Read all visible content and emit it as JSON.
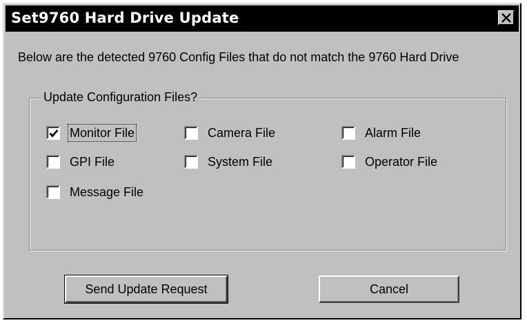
{
  "window": {
    "title": "Set9760 Hard Drive Update",
    "close_icon": "close-x-icon"
  },
  "description": "Below are the detected 9760 Config Files that do not match the 9760 Hard Drive",
  "group": {
    "legend": "Update Configuration Files?",
    "items": [
      {
        "label": "Monitor File",
        "checked": true,
        "focused": true
      },
      {
        "label": "Camera File",
        "checked": false
      },
      {
        "label": "Alarm File",
        "checked": false
      },
      {
        "label": "GPI File",
        "checked": false
      },
      {
        "label": "System File",
        "checked": false
      },
      {
        "label": "Operator File",
        "checked": false
      },
      {
        "label": "Message File",
        "checked": false
      }
    ]
  },
  "buttons": {
    "send_label": "Send Update Request",
    "cancel_label": "Cancel"
  }
}
